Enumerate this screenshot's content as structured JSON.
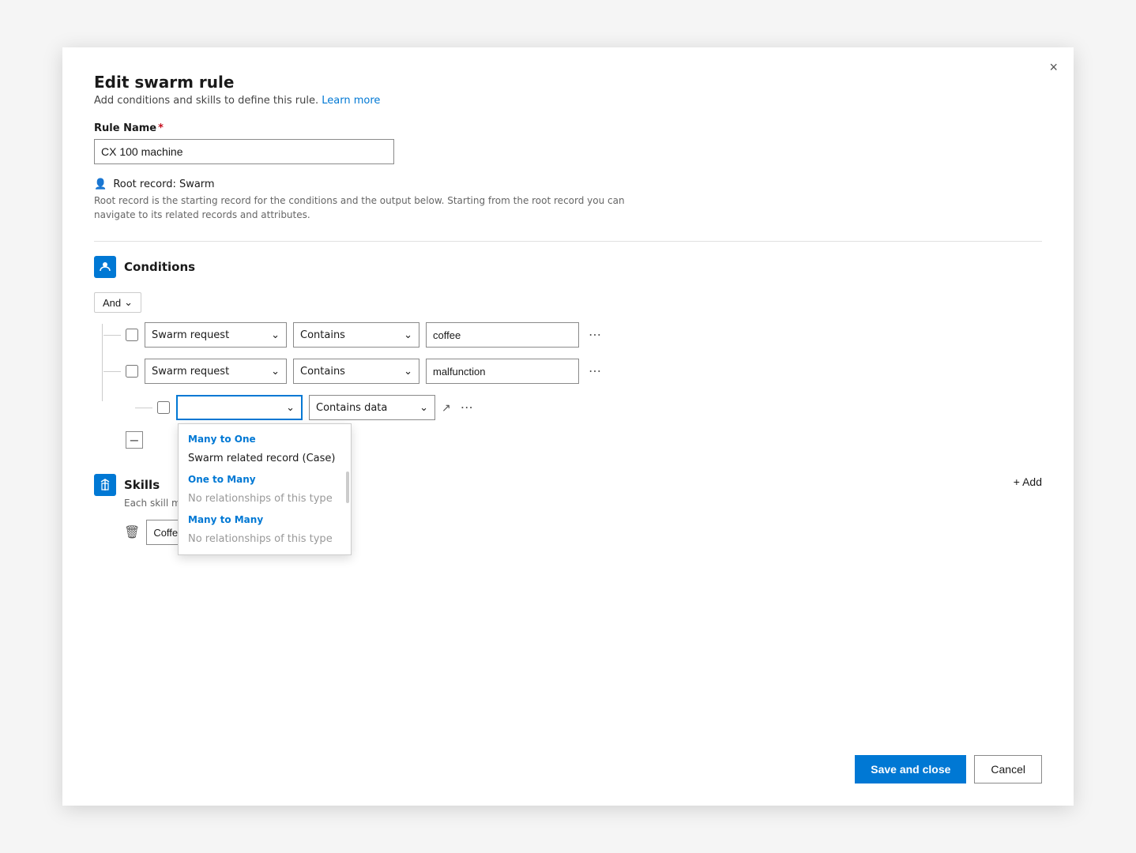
{
  "modal": {
    "title": "Edit swarm rule",
    "subtitle": "Add conditions and skills to define this rule.",
    "learn_more": "Learn more",
    "close_label": "×"
  },
  "rule_name": {
    "label": "Rule Name",
    "required": "*",
    "value": "CX 100 machine"
  },
  "root_record": {
    "label": "Root record: Swarm",
    "description": "Root record is the starting record for the conditions and the output below. Starting from the root record you can navigate to its related records and attributes."
  },
  "conditions": {
    "section_title": "Conditions",
    "and_label": "And",
    "row1": {
      "field": "Swarm request",
      "operator": "Contains",
      "value": "coffee"
    },
    "row2": {
      "field": "Swarm request",
      "operator": "Contains",
      "value": "malfunction"
    },
    "row3": {
      "field_placeholder": "",
      "operator": "Contains data",
      "dropdown_open": true
    },
    "dropdown_items": {
      "group1_label": "Many to One",
      "group1_item": "Swarm related record (Case)",
      "group2_label": "One to Many",
      "group2_item1_muted": "No relationships of this type",
      "group3_label": "Many to Many",
      "group3_item1_muted": "No relationships of this type"
    }
  },
  "skills": {
    "section_title": "Skills",
    "subtitle": "Each skill must be unique.",
    "add_label": "+ Add",
    "skill_value": "Coffee machine hardware",
    "skill_placeholder": "Coffee machine hardware"
  },
  "footer": {
    "save_label": "Save and close",
    "cancel_label": "Cancel"
  }
}
